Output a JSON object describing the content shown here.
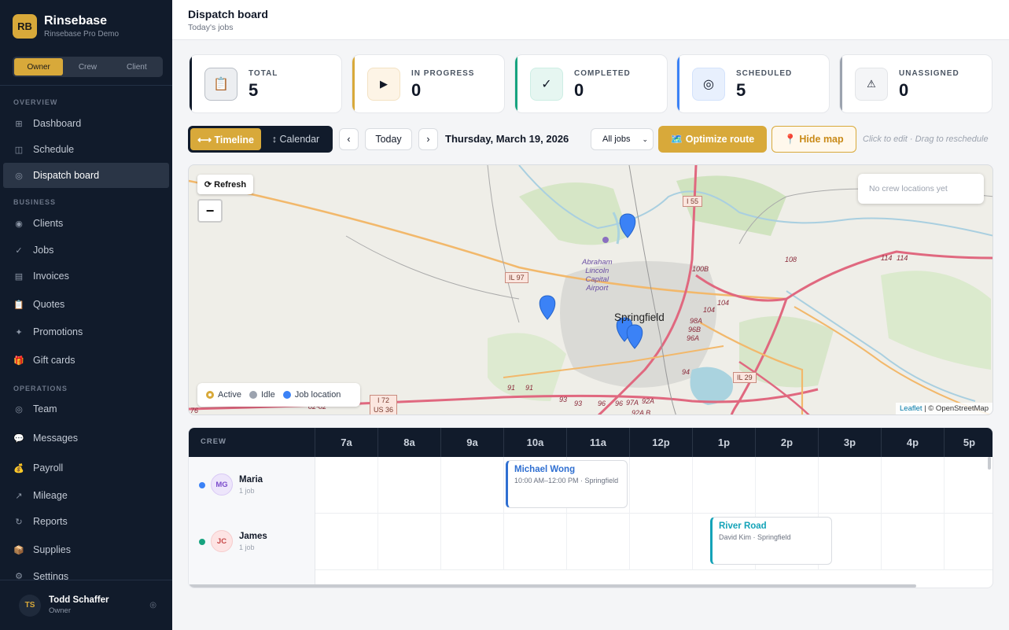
{
  "brand": {
    "logo": "RB",
    "name": "Rinsebase",
    "subtitle": "Rinsebase Pro Demo"
  },
  "roles": [
    "Owner",
    "Crew",
    "Client"
  ],
  "nav": {
    "overview_label": "OVERVIEW",
    "business_label": "BUSINESS",
    "operations_label": "OPERATIONS",
    "items": [
      {
        "label": "Dashboard",
        "icon": "grid-icon"
      },
      {
        "label": "Schedule",
        "icon": "calendar-icon"
      },
      {
        "label": "Dispatch board",
        "icon": "target-icon"
      },
      {
        "label": "Clients",
        "icon": "person-icon"
      },
      {
        "label": "Jobs",
        "icon": "check-icon"
      },
      {
        "label": "Invoices",
        "icon": "document-icon"
      },
      {
        "label": "Quotes",
        "icon": "clipboard-icon"
      },
      {
        "label": "Promotions",
        "icon": "sparkle-icon"
      },
      {
        "label": "Gift cards",
        "icon": "gift-icon"
      },
      {
        "label": "Team",
        "icon": "team-icon"
      },
      {
        "label": "Messages",
        "icon": "chat-icon"
      },
      {
        "label": "Payroll",
        "icon": "money-bag-icon"
      },
      {
        "label": "Mileage",
        "icon": "arrow-up-right-icon"
      },
      {
        "label": "Reports",
        "icon": "refresh-icon"
      },
      {
        "label": "Supplies",
        "icon": "box-icon"
      },
      {
        "label": "Settings",
        "icon": "gear-icon"
      }
    ]
  },
  "user": {
    "initials": "TS",
    "name": "Todd Schaffer",
    "role": "Owner"
  },
  "header": {
    "title": "Dispatch board",
    "subtitle": "Today's jobs"
  },
  "stats": [
    {
      "label": "TOTAL",
      "value": "5",
      "icon": "clipboard-icon",
      "color": "#111b2b"
    },
    {
      "label": "IN PROGRESS",
      "value": "0",
      "icon": "play-icon",
      "color": "#d8a93a"
    },
    {
      "label": "COMPLETED",
      "value": "0",
      "icon": "check-icon",
      "color": "#16a37f"
    },
    {
      "label": "SCHEDULED",
      "value": "5",
      "icon": "target-icon",
      "color": "#3b82f6"
    },
    {
      "label": "UNASSIGNED",
      "value": "0",
      "icon": "warning-icon",
      "color": "#9ca3af"
    }
  ],
  "toolbar": {
    "timeline": "⟷ Timeline",
    "calendar": "↕ Calendar",
    "prev": "‹",
    "today": "Today",
    "next": "›",
    "date": "Thursday, March 19, 2026",
    "filter": "All jobs",
    "optimize": "🗺️ Optimize route",
    "hide_map": "📍 Hide map",
    "hint": "Click to edit · Drag to reschedule"
  },
  "map": {
    "refresh": "⟳ Refresh",
    "zoom_out": "−",
    "crew_status": "No crew locations yet",
    "legend": [
      {
        "label": "Active",
        "color": "#d8a93a"
      },
      {
        "label": "Idle",
        "color": "#9ca3af"
      },
      {
        "label": "Job location",
        "color": "#3b82f6"
      }
    ],
    "attribution_leaflet": "Leaflet",
    "attribution_osm": "| © OpenStreetMap",
    "city": "Springfield",
    "airport": "Abraham\nLincoln\nCapital\nAirport",
    "shields": [
      "I 55",
      "IL 97",
      "IL 29",
      "I 72\nUS 36"
    ],
    "route_labels": [
      "108",
      "114",
      "114",
      "100B",
      "104",
      "104",
      "98A",
      "96B",
      "96A",
      "94",
      "91",
      "91",
      "93",
      "93",
      "96",
      "96",
      "97A",
      "92A",
      "92A B",
      "76",
      "82-82"
    ]
  },
  "timeline": {
    "crew_header": "CREW",
    "hours": [
      "7a",
      "8a",
      "9a",
      "10a",
      "11a",
      "12p",
      "1p",
      "2p",
      "3p",
      "4p",
      "5p"
    ],
    "crew": [
      {
        "initials": "MG",
        "name": "Maria",
        "count": "1 job",
        "dot": "#3b82f6",
        "av_bg": "#ede5fb",
        "av_fg": "#7c4dcc",
        "job": {
          "title": "Michael Wong",
          "sub": "10:00 AM–12:00 PM · Springfield",
          "color": "#2f6fd1"
        }
      },
      {
        "initials": "JC",
        "name": "James",
        "count": "1 job",
        "dot": "#16a37f",
        "av_bg": "#fde4e4",
        "av_fg": "#c74848",
        "job": {
          "title": "River Road",
          "sub": "David Kim · Springfield",
          "color": "#14a3b8"
        }
      }
    ]
  }
}
